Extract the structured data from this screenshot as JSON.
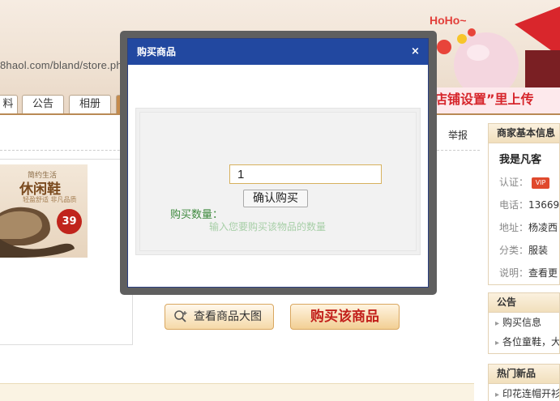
{
  "page": {
    "url_fragment": "8haol.com/bland/store.ph",
    "banner_hoho": "HoHo~",
    "banner_slogan": "店铺设置”里上传",
    "nav_tabs": [
      "料",
      "公告",
      "相册"
    ]
  },
  "product": {
    "report_label": "举报",
    "ad_line1": "简约生活",
    "ad_line2": "休闲鞋",
    "ad_line3": "轻盈舒适 非凡品质",
    "ad_price": "39",
    "view_large_label": "查看商品大图",
    "buy_label": "购买该商品"
  },
  "seller": {
    "title": "商家基本信息",
    "name": "我是凡客",
    "rows": [
      {
        "key": "认证：",
        "value": "VIP"
      },
      {
        "key": "电话：",
        "value": "13669"
      },
      {
        "key": "地址：",
        "value": "杨凌西"
      },
      {
        "key": "分类：",
        "value": "服装"
      },
      {
        "key": "说明：",
        "value": "查看更"
      }
    ]
  },
  "notice": {
    "title": "公告",
    "items": [
      "购买信息",
      "各位童鞋，大"
    ]
  },
  "hot": {
    "title": "热门新品",
    "items": [
      "印花连帽开衫"
    ]
  },
  "modal": {
    "title": "购买商品",
    "close_glyph": "×",
    "qty_label": "购买数量：",
    "qty_value": "1",
    "confirm_label": "确认购买",
    "hint": "输入您要购买该物品的数量"
  },
  "colors": {
    "modal_titlebar": "#2248a0",
    "qty_label": "#3f8a3f",
    "hint": "#a7cfa7",
    "buy_text": "#c2201b"
  }
}
